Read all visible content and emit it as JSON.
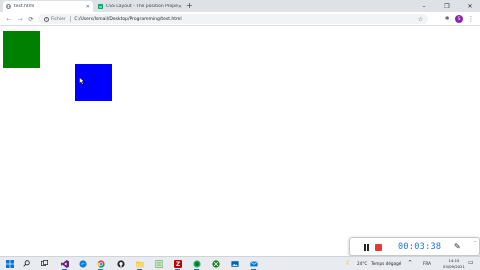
{
  "browser": {
    "tabs": [
      {
        "title": "test.html",
        "active": true,
        "favicon": "globe-icon"
      },
      {
        "title": "CSS Layout - The position Prope",
        "active": false,
        "favicon": "w3schools-icon"
      }
    ],
    "new_tab": "+",
    "window_controls": {
      "minimize": "–",
      "restore": "❐",
      "close": "✕"
    },
    "nav": {
      "back": "←",
      "forward": "→",
      "reload": "⟳"
    },
    "address": {
      "info": "i",
      "scheme": "Fichier",
      "url": "C:/Users/Ismail/Desktop/Programming/test.html"
    },
    "toolbar_icons": {
      "bookmark": "☆",
      "extensions": "✱",
      "menu": "⋮",
      "avatar_letter": "S"
    }
  },
  "page": {
    "colors": {
      "green_box": "#008000",
      "blue_box": "#0000ff"
    }
  },
  "recorder": {
    "time": "00:03:38",
    "colors": {
      "time": "#1a73e8",
      "stop": "#e53935"
    }
  },
  "taskbar": {
    "search_icon": "⌕",
    "apps": [
      "windows-start-icon",
      "search-icon",
      "task-view-icon",
      "visual-studio-icon",
      "edge-icon",
      "chrome-icon",
      "github-icon",
      "file-explorer-icon",
      "notepad-icon",
      "filezilla-icon",
      "spotify-icon",
      "xbox-icon",
      "photos-icon",
      "mail-icon"
    ],
    "weather": {
      "temp": "24°C",
      "desc": "Temps dégagé"
    },
    "language": "FRA",
    "clock": {
      "time": "14:15",
      "date": "03/09/2021"
    }
  }
}
